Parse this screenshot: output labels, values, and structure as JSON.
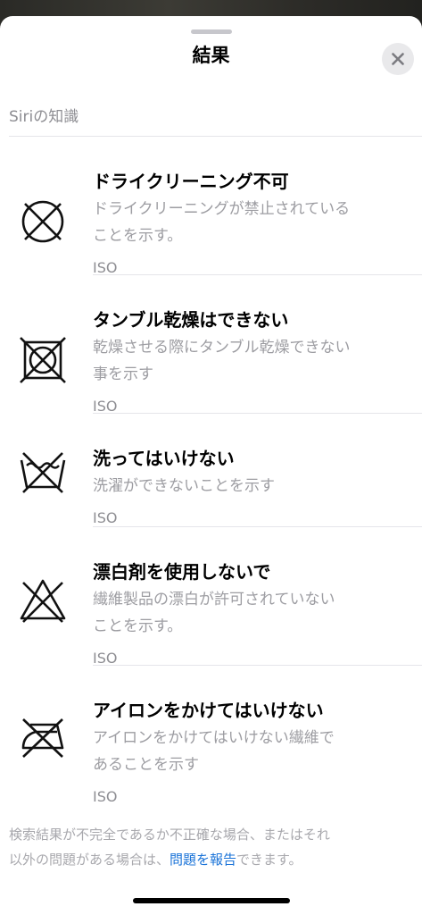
{
  "sheet": {
    "title": "結果"
  },
  "section": {
    "label": "Siriの知識"
  },
  "results": [
    {
      "title": "ドライクリーニング不可",
      "desc": [
        "ドライクリーニングが禁止されている",
        "ことを示す。"
      ],
      "source": "ISO",
      "icon": "no-dry-clean-icon"
    },
    {
      "title": "タンブル乾燥はできない",
      "desc": [
        "乾燥させる際にタンブル乾燥できない",
        "事を示す"
      ],
      "source": "ISO",
      "icon": "no-tumble-dry-icon"
    },
    {
      "title": "洗ってはいけない",
      "desc": [
        "洗濯ができないことを示す"
      ],
      "source": "ISO",
      "icon": "do-not-wash-icon"
    },
    {
      "title": "漂白剤を使用しないで",
      "desc": [
        "繊維製品の漂白が許可されていない",
        "ことを示す。"
      ],
      "source": "ISO",
      "icon": "no-bleach-icon"
    },
    {
      "title": "アイロンをかけてはいけない",
      "desc": [
        "アイロンをかけてはいけない繊維で",
        "あることを示す"
      ],
      "source": "ISO",
      "icon": "no-iron-icon"
    }
  ],
  "footer": {
    "line1": "検索結果が不完全であるか不正確な場合、またはそれ",
    "line2_prefix": "以外の問題がある場合は、",
    "link": "問題を報告",
    "line2_suffix": "できます。"
  },
  "colors": {
    "link": "#1a73d8",
    "secondary_text": "#9d9da2",
    "close_button_bg": "#e9e9eb"
  }
}
